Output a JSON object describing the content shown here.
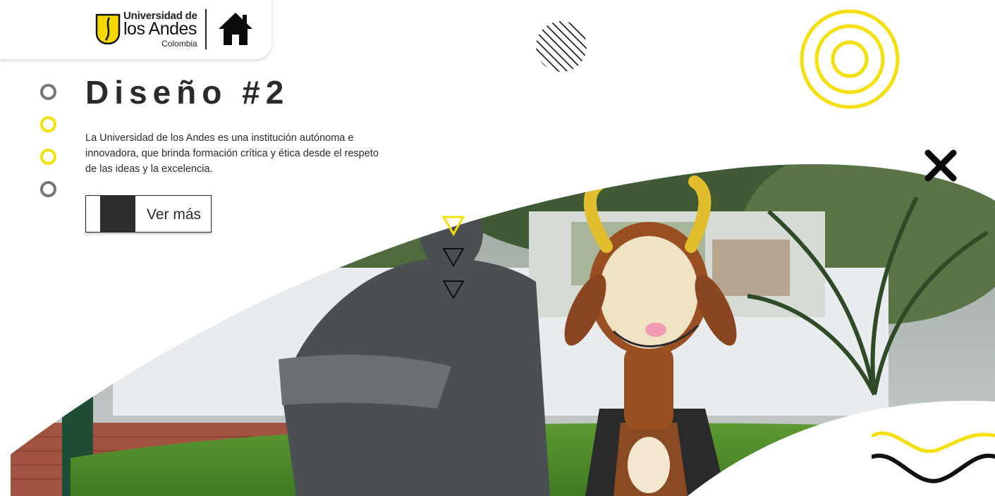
{
  "header": {
    "logo": {
      "line1": "Universidad de",
      "line2": "los Andes",
      "line3": "Colombia"
    },
    "home_icon": "home-icon"
  },
  "nav": {
    "dots": [
      "slide-1",
      "slide-2",
      "slide-3",
      "slide-4"
    ],
    "active_dot_color": "#f5e00b",
    "inactive_dot_color": "#777777"
  },
  "main": {
    "title": "Diseño #2",
    "description": "La Universidad de los Andes es una institución autónoma e innovadora, que brinda formación crítica y ética desde el respeto de las ideas y la excelencia.",
    "cta_label": "Ver más"
  },
  "colors": {
    "accent": "#f5e00b",
    "dark": "#2b2b2b"
  },
  "decorations": {
    "icons": [
      "striped-circle-icon",
      "concentric-circles-icon",
      "close-x-icon",
      "triangles-icon",
      "wave-lines-icon"
    ]
  }
}
